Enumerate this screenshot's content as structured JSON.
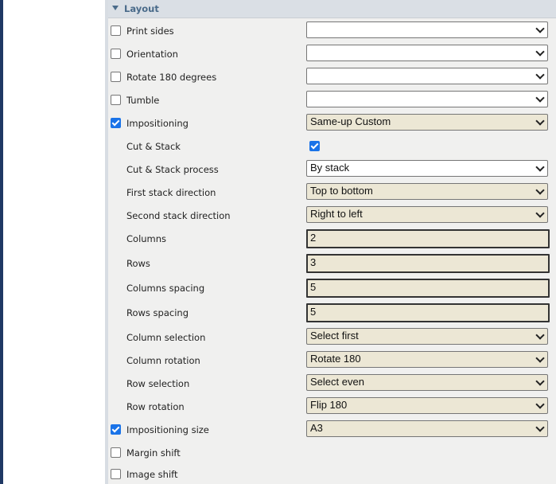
{
  "section": {
    "title": "Layout"
  },
  "rows": {
    "print_sides": {
      "label": "Print sides",
      "checked": false,
      "value": ""
    },
    "orientation": {
      "label": "Orientation",
      "checked": false,
      "value": ""
    },
    "rotate_180": {
      "label": "Rotate 180 degrees",
      "checked": false,
      "value": ""
    },
    "tumble": {
      "label": "Tumble",
      "checked": false,
      "value": ""
    },
    "impositioning": {
      "label": "Impositioning",
      "checked": true,
      "value": "Same-up Custom"
    },
    "cut_stack": {
      "label": "Cut & Stack",
      "checked": true
    },
    "cut_stack_process": {
      "label": "Cut & Stack process",
      "value": "By stack"
    },
    "first_stack_direction": {
      "label": "First stack direction",
      "value": "Top to bottom"
    },
    "second_stack_direction": {
      "label": "Second stack direction",
      "value": "Right to left"
    },
    "columns": {
      "label": "Columns",
      "value": "2"
    },
    "rows_count": {
      "label": "Rows",
      "value": "3"
    },
    "columns_spacing": {
      "label": "Columns spacing",
      "value": "5"
    },
    "rows_spacing": {
      "label": "Rows spacing",
      "value": "5"
    },
    "column_selection": {
      "label": "Column selection",
      "value": "Select first"
    },
    "column_rotation": {
      "label": "Column rotation",
      "value": "Rotate 180"
    },
    "row_selection": {
      "label": "Row selection",
      "value": "Select even"
    },
    "row_rotation": {
      "label": "Row rotation",
      "value": "Flip 180"
    },
    "impositioning_size": {
      "label": "Impositioning size",
      "checked": true,
      "value": "A3"
    },
    "margin_shift": {
      "label": "Margin shift",
      "checked": false
    },
    "image_shift": {
      "label": "Image shift",
      "checked": false
    }
  },
  "colors": {
    "accent": "#1a73e8",
    "section_header_text": "#4a6b8a",
    "filled_field": "#ece7d5",
    "left_border": "#1f3864"
  }
}
